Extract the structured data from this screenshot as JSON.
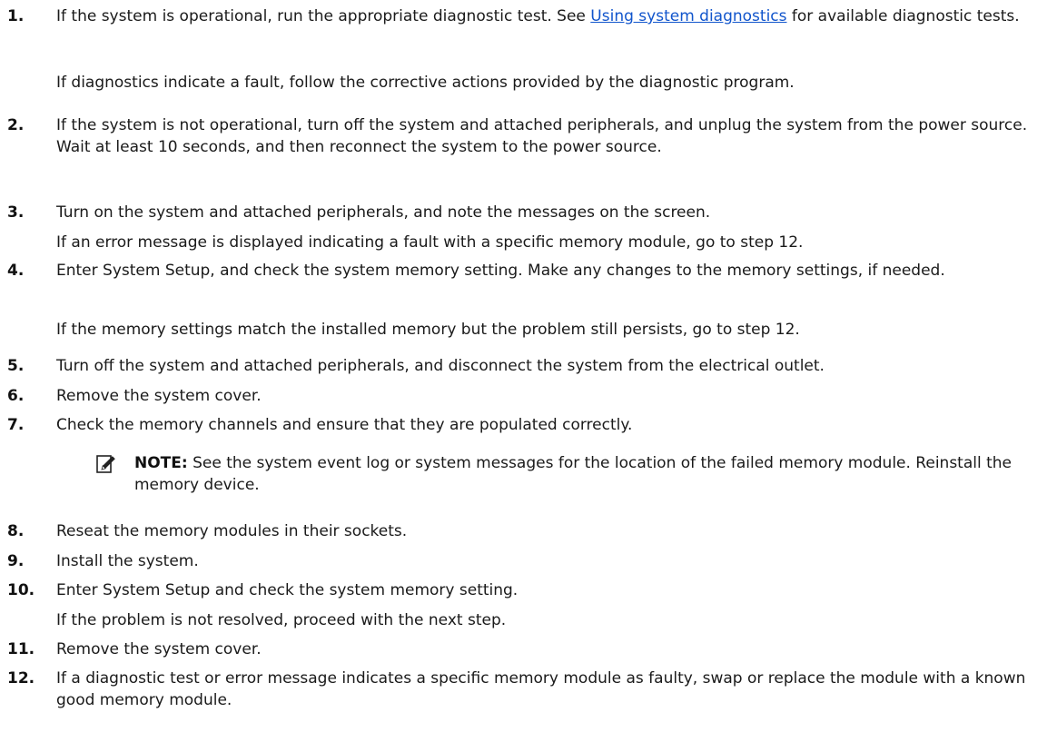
{
  "steps": [
    {
      "num": "1.",
      "pre": "If the system is operational, run the appropriate diagnostic test. See ",
      "link": "Using system diagnostics",
      "post": " for available diagnostic tests.",
      "sub": "If diagnostics indicate a fault, follow the corrective actions provided by the diagnostic program."
    },
    {
      "num": "2.",
      "text": "If the system is not operational, turn off the system and attached peripherals, and unplug the system from the power source. Wait at least 10 seconds, and then reconnect the system to the power source."
    },
    {
      "num": "3.",
      "text": "Turn on the system and attached peripherals, and note the messages on the screen.",
      "sub": "If an error message is displayed indicating a fault with a specific memory module, go to step 12."
    },
    {
      "num": "4.",
      "text": "Enter System Setup, and check the system memory setting. Make any changes to the memory settings, if needed.",
      "sub": "If the memory settings match the installed memory but the problem still persists, go to step 12."
    },
    {
      "num": "5.",
      "text": "Turn off the system and attached peripherals, and disconnect the system from the electrical outlet."
    },
    {
      "num": "6.",
      "text": "Remove the system cover."
    },
    {
      "num": "7.",
      "text": "Check the memory channels and ensure that they are populated correctly."
    },
    {
      "num": "8.",
      "text": "Reseat the memory modules in their sockets."
    },
    {
      "num": "9.",
      "text": "Install the system."
    },
    {
      "num": "10.",
      "text": "Enter System Setup and check the system memory setting.",
      "sub": "If the problem is not resolved, proceed with the next step."
    },
    {
      "num": "11.",
      "text": "Remove the system cover."
    },
    {
      "num": "12.",
      "text": "If a diagnostic test or error message indicates a specific memory module as faulty, swap or replace the module with a known good memory module."
    }
  ],
  "note": {
    "label": "NOTE:",
    "text": " See the system event log or system messages for the location of the failed memory module. Reinstall the memory device.",
    "icon": "note-pencil-icon"
  }
}
